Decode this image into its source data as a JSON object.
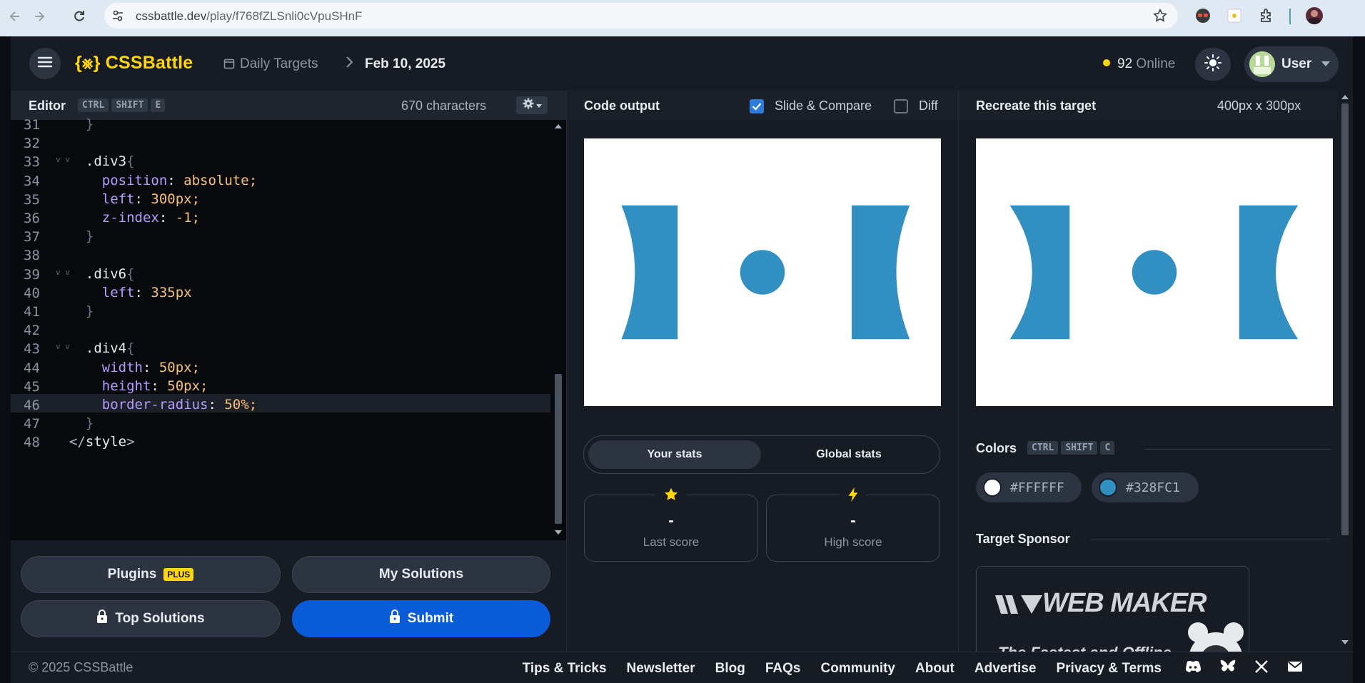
{
  "browser": {
    "url_host": "cssbattle.dev",
    "url_path": "/play/f768fZLSnli0cVpuSHnF"
  },
  "header": {
    "logo": "{⨳} CSSBattle",
    "breadcrumb_root": "Daily Targets",
    "breadcrumb_current": "Feb 10, 2025",
    "online_count": "92",
    "online_label": "Online",
    "user_name": "User"
  },
  "editor": {
    "title": "Editor",
    "shortcut": [
      "CTRL",
      "SHIFT",
      "E"
    ],
    "characters": "670 characters",
    "active_line": 46,
    "lines": [
      {
        "n": "31",
        "fold": false,
        "segments": [
          {
            "t": "  ",
            "c": "punct"
          },
          {
            "t": "}",
            "c": "brace"
          }
        ]
      },
      {
        "n": "32",
        "fold": false,
        "segments": []
      },
      {
        "n": "33",
        "fold": true,
        "segments": [
          {
            "t": "  .div3",
            "c": "sel"
          },
          {
            "t": "{",
            "c": "brace"
          }
        ]
      },
      {
        "n": "34",
        "fold": false,
        "segments": [
          {
            "t": "    position",
            "c": "prop"
          },
          {
            "t": ": ",
            "c": "punct"
          },
          {
            "t": "absolute",
            "c": "val"
          },
          {
            "t": ";",
            "c": "val"
          }
        ]
      },
      {
        "n": "35",
        "fold": false,
        "segments": [
          {
            "t": "    left",
            "c": "prop"
          },
          {
            "t": ": ",
            "c": "punct"
          },
          {
            "t": "300",
            "c": "val"
          },
          {
            "t": "px;",
            "c": "val"
          }
        ]
      },
      {
        "n": "36",
        "fold": false,
        "segments": [
          {
            "t": "    z-index",
            "c": "prop"
          },
          {
            "t": ": ",
            "c": "punct"
          },
          {
            "t": "-1",
            "c": "val"
          },
          {
            "t": ";",
            "c": "val"
          }
        ]
      },
      {
        "n": "37",
        "fold": false,
        "segments": [
          {
            "t": "  ",
            "c": "punct"
          },
          {
            "t": "}",
            "c": "brace"
          }
        ]
      },
      {
        "n": "38",
        "fold": false,
        "segments": []
      },
      {
        "n": "39",
        "fold": true,
        "segments": [
          {
            "t": "  .div6",
            "c": "sel"
          },
          {
            "t": "{",
            "c": "brace"
          }
        ]
      },
      {
        "n": "40",
        "fold": false,
        "segments": [
          {
            "t": "    left",
            "c": "prop"
          },
          {
            "t": ": ",
            "c": "punct"
          },
          {
            "t": "335px",
            "c": "val"
          }
        ]
      },
      {
        "n": "41",
        "fold": false,
        "segments": [
          {
            "t": "  ",
            "c": "punct"
          },
          {
            "t": "}",
            "c": "brace"
          }
        ]
      },
      {
        "n": "42",
        "fold": false,
        "segments": []
      },
      {
        "n": "43",
        "fold": true,
        "segments": [
          {
            "t": "  .div4",
            "c": "sel"
          },
          {
            "t": "{",
            "c": "brace"
          }
        ]
      },
      {
        "n": "44",
        "fold": false,
        "segments": [
          {
            "t": "    width",
            "c": "prop"
          },
          {
            "t": ": ",
            "c": "punct"
          },
          {
            "t": "50",
            "c": "val"
          },
          {
            "t": "px;",
            "c": "val"
          }
        ]
      },
      {
        "n": "45",
        "fold": false,
        "segments": [
          {
            "t": "    height",
            "c": "prop"
          },
          {
            "t": ": ",
            "c": "punct"
          },
          {
            "t": "50",
            "c": "val"
          },
          {
            "t": "px;",
            "c": "val"
          }
        ]
      },
      {
        "n": "46",
        "fold": false,
        "segments": [
          {
            "t": "    border-radius",
            "c": "prop"
          },
          {
            "t": ": ",
            "c": "punct"
          },
          {
            "t": "50",
            "c": "val"
          },
          {
            "t": "%;",
            "c": "val"
          }
        ]
      },
      {
        "n": "47",
        "fold": false,
        "segments": [
          {
            "t": "  ",
            "c": "punct"
          },
          {
            "t": "}",
            "c": "brace"
          }
        ]
      },
      {
        "n": "48",
        "fold": false,
        "segments": [
          {
            "t": "</",
            "c": "tag"
          },
          {
            "t": "style",
            "c": "sel"
          },
          {
            "t": ">",
            "c": "tag"
          }
        ]
      }
    ]
  },
  "buttons": {
    "plugins": "Plugins",
    "plugins_badge": "PLUS",
    "my_solutions": "My Solutions",
    "top_solutions": "Top Solutions",
    "submit": "Submit"
  },
  "output": {
    "title": "Code output",
    "slide_compare": "Slide & Compare",
    "slide_compare_checked": true,
    "diff": "Diff",
    "diff_checked": false
  },
  "stats": {
    "tab_your": "Your stats",
    "tab_global": "Global stats",
    "last_score_value": "-",
    "last_score_label": "Last score",
    "high_score_value": "-",
    "high_score_label": "High score"
  },
  "target": {
    "title": "Recreate this target",
    "size": "400px x 300px",
    "colors_title": "Colors",
    "colors_shortcut": [
      "CTRL",
      "SHIFT",
      "C"
    ],
    "colors": [
      {
        "hex": "#FFFFFF",
        "label": "#FFFFFF"
      },
      {
        "hex": "#328FC1",
        "label": "#328FC1"
      }
    ],
    "sponsor_title": "Target Sponsor",
    "sponsor_brand": "WEB MAKER",
    "sponsor_tagline": "The Fastest and Offline"
  },
  "footer": {
    "copyright": "© 2025 CSSBattle",
    "links": [
      "Tips & Tricks",
      "Newsletter",
      "Blog",
      "FAQs",
      "Community",
      "About",
      "Advertise",
      "Privacy & Terms"
    ]
  },
  "icons": {
    "back": "arrow-left-icon",
    "forward": "arrow-right-icon",
    "reload": "reload-icon",
    "bookmark": "star-icon",
    "menu": "hamburger-icon",
    "theme": "sun-icon",
    "settings": "gear-icon",
    "lock": "lock-icon",
    "discord": "discord-icon",
    "bluesky": "butterfly-icon",
    "x": "x-icon",
    "mail": "mail-icon"
  },
  "accent_colors": {
    "brand_yellow": "#ffd60a",
    "submit_blue": "#0a5bd7",
    "shape_blue": "#328FC1"
  }
}
